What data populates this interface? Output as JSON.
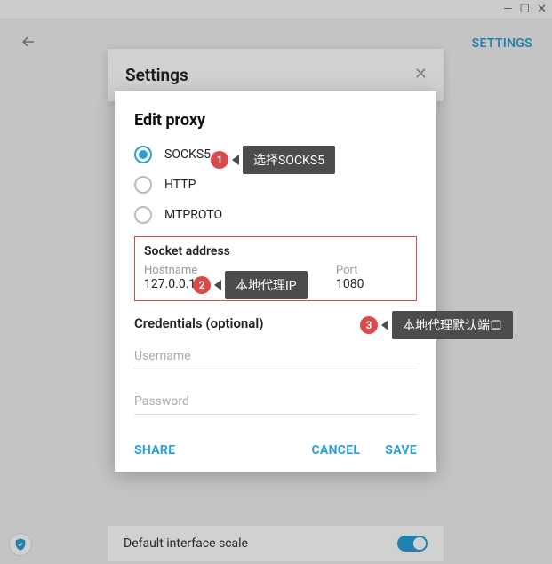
{
  "titlebar": {
    "min": "—",
    "max": "☐",
    "close": "✕"
  },
  "header": {
    "settings_link": "SETTINGS"
  },
  "settings_panel": {
    "title": "Settings"
  },
  "bottom": {
    "label": "Default interface scale"
  },
  "dialog": {
    "title": "Edit proxy",
    "radios": {
      "socks5": "SOCKS5",
      "http": "HTTP",
      "mtproto": "MTPROTO"
    },
    "socket": {
      "section": "Socket address",
      "hostname_label": "Hostname",
      "hostname_value": "127.0.0.1",
      "port_label": "Port",
      "port_value": "1080"
    },
    "credentials": {
      "section": "Credentials (optional)",
      "username_ph": "Username",
      "password_ph": "Password"
    },
    "actions": {
      "share": "SHARE",
      "cancel": "CANCEL",
      "save": "SAVE"
    }
  },
  "callouts": {
    "c1": {
      "num": "1",
      "text": "选择SOCKS5"
    },
    "c2": {
      "num": "2",
      "text": "本地代理IP"
    },
    "c3": {
      "num": "3",
      "text": "本地代理默认端口"
    }
  }
}
